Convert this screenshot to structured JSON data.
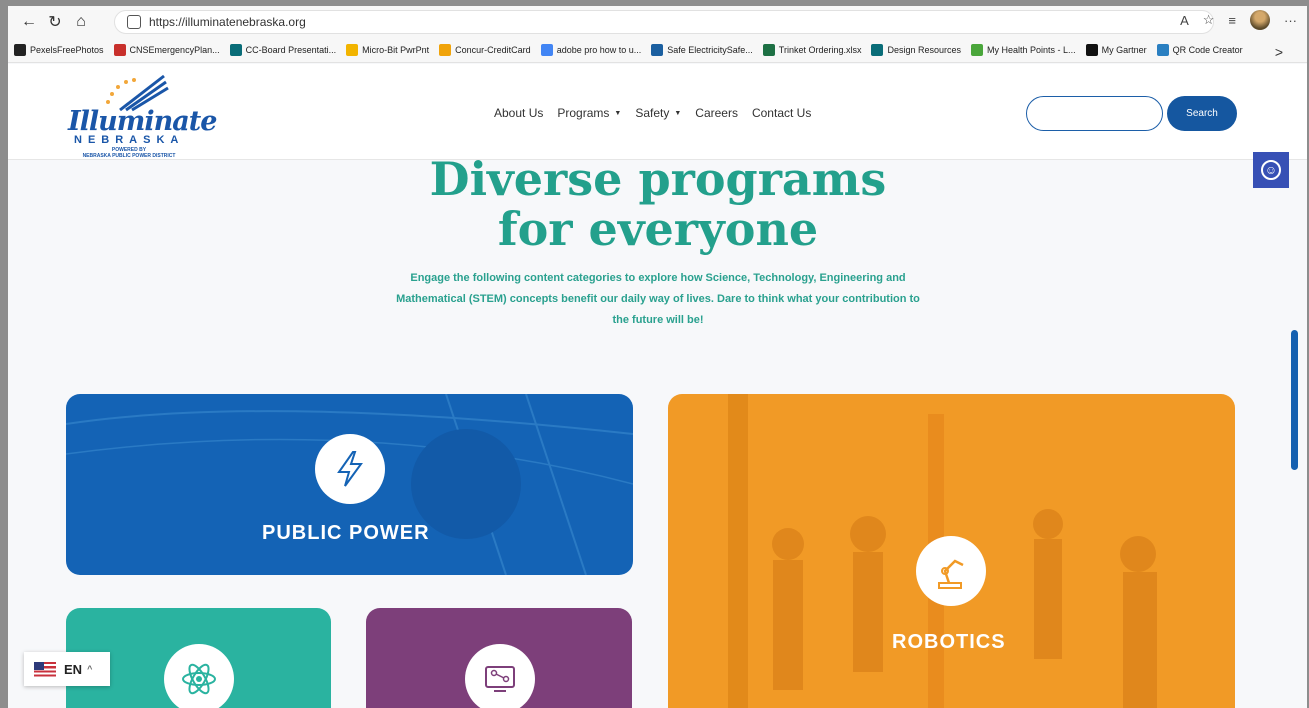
{
  "browser": {
    "url": "https://illuminatenebraska.org",
    "toolbar_icons": [
      "back-icon",
      "reload-icon",
      "home-icon",
      "read-aloud-icon",
      "favorite-star-icon",
      "favorites-icon",
      "profile-avatar",
      "more-icon"
    ],
    "more_label": "···",
    "read_aloud_label": "A",
    "chevron_label": ">"
  },
  "bookmarks": [
    {
      "label": "PexelsFreePhotos",
      "icon": "pexels-icon",
      "color": "#222222"
    },
    {
      "label": "CNSEmergencyPlan...",
      "icon": "pdf-icon",
      "color": "#c8302b"
    },
    {
      "label": "CC-Board Presentati...",
      "icon": "sharepoint-icon",
      "color": "#0a6d78"
    },
    {
      "label": "Micro-Bit PwrPnt",
      "icon": "slides-icon",
      "color": "#f2b400"
    },
    {
      "label": "Concur-CreditCard",
      "icon": "concur-icon",
      "color": "#f0a30a"
    },
    {
      "label": "adobe pro how to u...",
      "icon": "google-icon",
      "color": "#4285f4"
    },
    {
      "label": "Safe ElectricitySafe...",
      "icon": "safe-electricity-icon",
      "color": "#1b5fa0"
    },
    {
      "label": "Trinket Ordering.xlsx",
      "icon": "excel-icon",
      "color": "#1d7044"
    },
    {
      "label": "Design Resources",
      "icon": "sharepoint-icon",
      "color": "#0a6d78"
    },
    {
      "label": "My Health Points - L...",
      "icon": "health-icon",
      "color": "#4aa63b"
    },
    {
      "label": "My Gartner",
      "icon": "gartner-icon",
      "color": "#111111"
    },
    {
      "label": "QR Code Creator",
      "icon": "qr-icon",
      "color": "#2a7fc1"
    }
  ],
  "site": {
    "logo": {
      "word": "Illuminate",
      "sub": "NEBRASKA",
      "powered": "POWERED BY",
      "district": "NEBRASKA PUBLIC POWER DISTRICT"
    },
    "nav": [
      {
        "label": "About Us",
        "has_dropdown": false
      },
      {
        "label": "Programs",
        "has_dropdown": true
      },
      {
        "label": "Safety",
        "has_dropdown": true
      },
      {
        "label": "Careers",
        "has_dropdown": false
      },
      {
        "label": "Contact Us",
        "has_dropdown": false
      }
    ],
    "caret": "▼",
    "search": {
      "placeholder": "",
      "button_label": "Search"
    }
  },
  "hero": {
    "title_line1": "Diverse programs",
    "title_line2": "for everyone",
    "description": "Engage the following content categories to explore how Science, Technology, Engineering and Mathematical (STEM) concepts benefit our daily way of lives. Dare to think what your contribution to the future will be!"
  },
  "cards": {
    "public_power": {
      "label": "PUBLIC POWER",
      "icon": "lightning-bolt-icon"
    },
    "robotics": {
      "label": "ROBOTICS",
      "icon": "robot-arm-icon"
    },
    "science": {
      "label": "",
      "icon": "atom-icon"
    },
    "technology": {
      "label": "",
      "icon": "computer-network-icon"
    }
  },
  "language": {
    "code": "EN",
    "caret": "^"
  },
  "colors": {
    "brand_blue": "#1557a0",
    "teal": "#23a08c",
    "orange": "#f19a26",
    "purple": "#7d3f7a",
    "a11y": "#3750b5"
  }
}
